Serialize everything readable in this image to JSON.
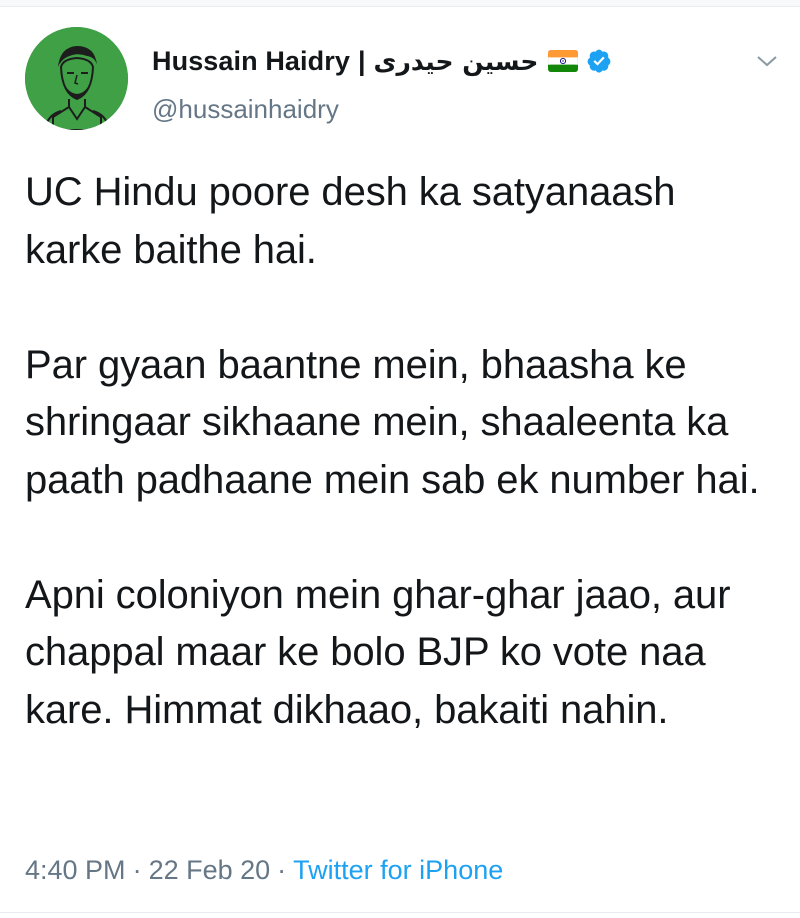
{
  "author": {
    "display_name": "Hussain Haidry",
    "separator": "|",
    "display_name_urdu": "حسین حیدری",
    "handle": "@hussainhaidry",
    "flag_icon": "india-flag-icon",
    "verified_icon": "verified-badge-icon",
    "avatar_color": "#3fa046"
  },
  "tweet": {
    "paragraphs": [
      "UC Hindu poore desh ka satyanaash karke baithe hai.",
      "Par gyaan baantne mein, bhaasha ke shringaar sikhaane mein, shaaleenta ka paath padhaane mein sab ek number hai.",
      "Apni coloniyon mein ghar-ghar jaao, aur chappal maar ke bolo BJP ko vote naa kare. Himmat dikhaao, bakaiti nahin."
    ]
  },
  "meta": {
    "time": "4:40 PM",
    "date": "22 Feb 20",
    "separator": "·",
    "source": "Twitter for iPhone"
  },
  "menu": {
    "icon": "chevron-down-icon"
  },
  "colors": {
    "text": "#14171a",
    "secondary": "#657786",
    "link": "#1da1f2",
    "verified": "#1da1f2"
  }
}
